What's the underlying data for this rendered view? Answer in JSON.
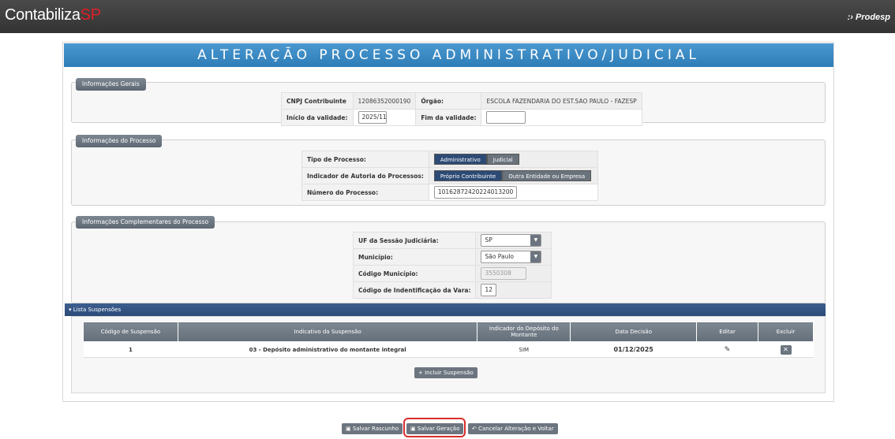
{
  "header": {
    "brand_main": "Contabiliza",
    "brand_accent": "SP",
    "partner": "Prodesp"
  },
  "page_title": "ALTERAÇÃO PROCESSO ADMINISTRATIVO/JUDICIAL",
  "info_gerais": {
    "legend": "Informações Gerais",
    "cnpj_label": "CNPJ Contribuinte",
    "cnpj_value": "12086352000190",
    "orgao_label": "Órgão:",
    "orgao_value": "ESCOLA FAZENDARIA DO EST.SAO PAULO - FAZESP",
    "inicio_label": "Início da validade:",
    "inicio_value": "2025/11",
    "fim_label": "Fim da validade:",
    "fim_value": ""
  },
  "info_processo": {
    "legend": "Informações do Processo",
    "tipo_label": "Tipo de Processo:",
    "tipo_options": [
      "Administrativo",
      "Judicial"
    ],
    "tipo_selected": "Administrativo",
    "autoria_label": "Indicador de Autoria do Processos:",
    "autoria_options": [
      "Próprio Contribuinte",
      "Outra Entidade ou Empresa"
    ],
    "autoria_selected": "Próprio Contribuinte",
    "numero_label": "Número do Processo:",
    "numero_value": "10162872420224013200"
  },
  "info_complementares": {
    "legend": "Informações Complementares do Processo",
    "uf_label": "UF da Sessão Judiciária:",
    "uf_value": "SP",
    "municipio_label": "Município:",
    "municipio_value": "São Paulo",
    "cod_municipio_label": "Código Município:",
    "cod_municipio_value": "3550308",
    "cod_vara_label": "Código de Indentificação da Vara:",
    "cod_vara_value": "12"
  },
  "lista": {
    "title": "▾ Lista Suspensões",
    "columns": [
      "Código de Suspensão",
      "Indicativo da Suspensão",
      "Indicador do Depósito do Montante",
      "Data Decisão",
      "Editar",
      "Excluir"
    ],
    "rows": [
      {
        "codigo": "1",
        "indicativo": "03 - Depósito administrativo do montante integral",
        "deposito": "SIM",
        "data": "01/12/2025"
      }
    ],
    "incluir_label": "+ Incluir Suspensão"
  },
  "actions": {
    "rascunho_label": "Salvar Rascunho",
    "geracao_label": "Salvar Geração",
    "cancelar_label": "Cancelar Alteração e Voltar"
  },
  "colors": {
    "accent": "#2f7db8",
    "highlight": "#d92d2d",
    "button": "#6c757f"
  }
}
